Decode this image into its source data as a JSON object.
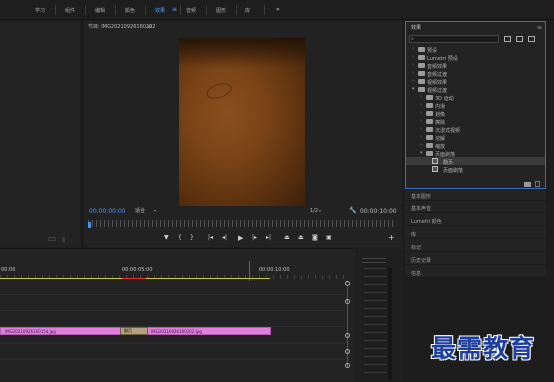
{
  "menu": {
    "items": [
      {
        "label": "学习",
        "active": false
      },
      {
        "label": "组件",
        "active": false
      },
      {
        "label": "编辑",
        "active": false
      },
      {
        "label": "颜色",
        "active": false
      },
      {
        "label": "效果",
        "active": true
      },
      {
        "label": "音频",
        "active": false
      },
      {
        "label": "图形",
        "active": false
      },
      {
        "label": "库",
        "active": false
      }
    ],
    "workspace_menu_icon": "hamburger-icon",
    "more_label": "»"
  },
  "program_monitor": {
    "title": "节目: IMG20210926160202",
    "menu_icon": "hamburger-icon",
    "timecode": "00:00:00:00",
    "fit": "适合",
    "resolution": "1/2",
    "duration": "00:00:10:00"
  },
  "effects_panel": {
    "title": "效果",
    "search_placeholder": "",
    "tree": [
      {
        "label": "预设",
        "type": "folder",
        "depth": 0,
        "expanded": false
      },
      {
        "label": "Lumetri 预设",
        "type": "folder",
        "depth": 0,
        "expanded": false
      },
      {
        "label": "音频效果",
        "type": "folder",
        "depth": 0,
        "expanded": false
      },
      {
        "label": "音频过渡",
        "type": "folder",
        "depth": 0,
        "expanded": false
      },
      {
        "label": "视频效果",
        "type": "folder",
        "depth": 0,
        "expanded": false
      },
      {
        "label": "视频过渡",
        "type": "folder",
        "depth": 0,
        "expanded": true
      },
      {
        "label": "3D 运动",
        "type": "folder",
        "depth": 1,
        "expanded": false
      },
      {
        "label": "内滑",
        "type": "folder",
        "depth": 1,
        "expanded": false
      },
      {
        "label": "划像",
        "type": "folder",
        "depth": 1,
        "expanded": false
      },
      {
        "label": "擦除",
        "type": "folder",
        "depth": 1,
        "expanded": false
      },
      {
        "label": "沉浸式视频",
        "type": "folder",
        "depth": 1,
        "expanded": false
      },
      {
        "label": "溶解",
        "type": "folder",
        "depth": 1,
        "expanded": false
      },
      {
        "label": "缩放",
        "type": "folder",
        "depth": 1,
        "expanded": false
      },
      {
        "label": "页面剥落",
        "type": "folder",
        "depth": 1,
        "expanded": true
      },
      {
        "label": "翻页",
        "type": "effect",
        "depth": 2,
        "selected": true
      },
      {
        "label": "页面剥落",
        "type": "effect",
        "depth": 2,
        "selected": false
      }
    ]
  },
  "right_panels": [
    "基本图形",
    "基本声音",
    "Lumetri 颜色",
    "库",
    "标记",
    "历史记录",
    "信息"
  ],
  "timeline": {
    "ruler": [
      "00:00",
      "00:00:05:00",
      "00:00:10:00"
    ],
    "clips": [
      {
        "label": "IMG20210926160154.jpg"
      },
      {
        "label": "翻页"
      },
      {
        "label": "IMG20210926160202.jpg"
      }
    ]
  },
  "watermark": "最需教育",
  "colors": {
    "accent_blue": "#4d8cf5",
    "clip_pink": "#e07ee0",
    "work_area_yellow": "#c8c832",
    "selection_border": "#3a6fb8"
  }
}
